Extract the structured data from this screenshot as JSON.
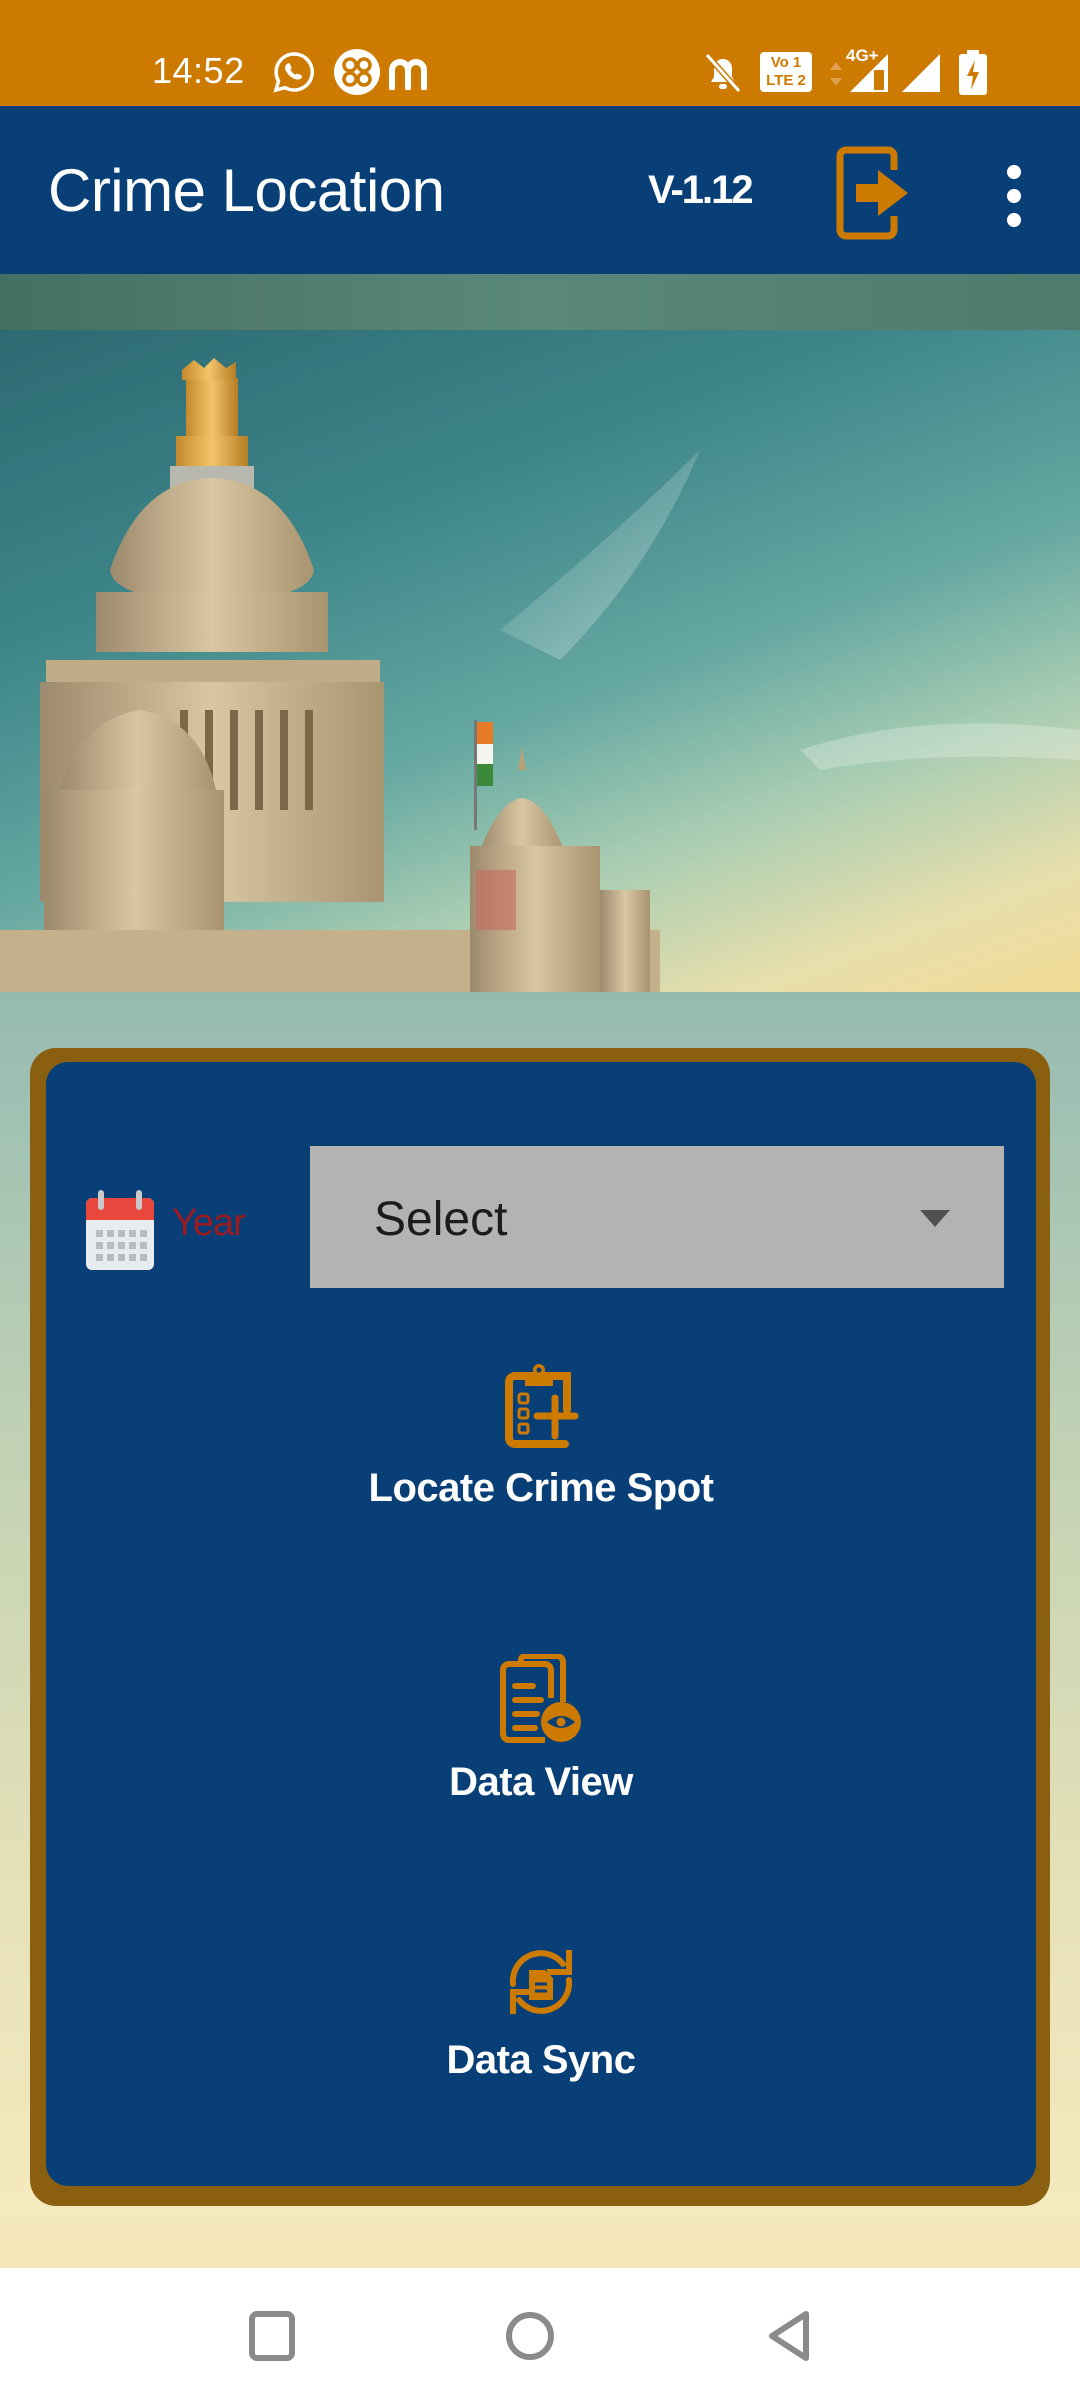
{
  "status_bar": {
    "time": "14:52",
    "left_icons": [
      "whatsapp-icon",
      "app-grid-icon",
      "m-app-icon"
    ],
    "right_icons": [
      "notifications-muted-icon",
      "volte-lte-icon",
      "data-arrows-icon",
      "signal-4g-plus-icon",
      "signal-icon",
      "battery-charging-icon"
    ],
    "volte_text_top": "Vo 1",
    "volte_text_bottom": "LTE 2",
    "network_label": "4G+"
  },
  "app_bar": {
    "title": "Crime Location",
    "version": "V-1.12",
    "logout_icon": "logout-icon",
    "more_icon": "more-vert-icon"
  },
  "hero": {
    "description": "Government building dome against sky"
  },
  "card": {
    "year_label": "Year",
    "year_select": {
      "value": "Select"
    },
    "menu": [
      {
        "label": "Locate Crime Spot",
        "icon": "clipboard-add-icon"
      },
      {
        "label": "Data View",
        "icon": "document-view-icon"
      },
      {
        "label": "Data Sync",
        "icon": "document-sync-icon"
      }
    ]
  },
  "colors": {
    "status_bar": "#cc7a00",
    "app_bar": "#083f77",
    "accent": "#cc7a00",
    "card_border": "#8a6010",
    "year_label": "#9b1b20",
    "select_bg": "#b3b4b1"
  },
  "nav_bar": {
    "buttons": [
      "recents-button",
      "home-button",
      "back-button"
    ]
  }
}
